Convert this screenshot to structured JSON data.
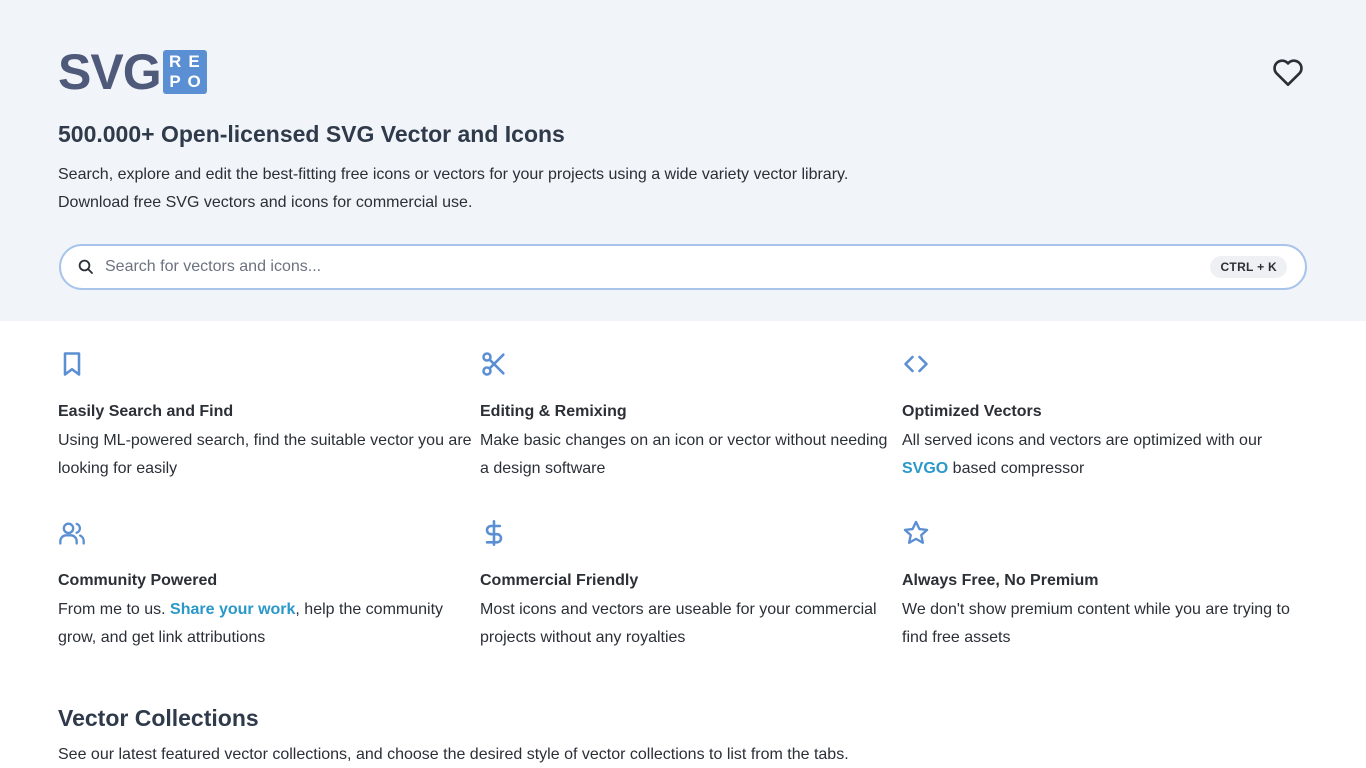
{
  "header": {
    "logo_text": "SVG",
    "logo_box": [
      "R",
      "E",
      "P",
      "O"
    ],
    "favorite_icon": "heart-icon"
  },
  "hero": {
    "title": "500.000+ Open-licensed SVG Vector and Icons",
    "desc_line1": "Search, explore and edit the best-fitting free icons or vectors for your projects using a wide variety vector library.",
    "desc_line2": "Download free SVG vectors and icons for commercial use."
  },
  "search": {
    "placeholder": "Search for vectors and icons...",
    "value": "",
    "shortcut": "CTRL + K",
    "icon": "search-icon"
  },
  "features": [
    {
      "icon": "bookmark-icon",
      "title": "Easily Search and Find",
      "text": "Using ML-powered search, find the suitable vector you are looking for easily"
    },
    {
      "icon": "scissors-icon",
      "title": "Editing & Remixing",
      "text": "Make basic changes on an icon or vector without needing a design software"
    },
    {
      "icon": "code-icon",
      "title": "Optimized Vectors",
      "text_before": "All served icons and vectors are optimized with our ",
      "link": "SVGO",
      "text_after": " based compressor"
    },
    {
      "icon": "users-icon",
      "title": "Community Powered",
      "text_before": "From me to us. ",
      "link": "Share your work",
      "text_after": ", help the community grow, and get link attributions"
    },
    {
      "icon": "dollar-icon",
      "title": "Commercial Friendly",
      "text": "Most icons and vectors are useable for your commercial projects without any royalties"
    },
    {
      "icon": "star-icon",
      "title": "Always Free, No Premium",
      "text": "We don't show premium content while you are trying to find free assets"
    }
  ],
  "collections": {
    "title": "Vector Collections",
    "desc": "See our latest featured vector collections, and choose the desired style of vector collections to list from the tabs."
  },
  "colors": {
    "accent": "#5b8fd3",
    "link": "#2a98c9",
    "hero_bg": "#f1f4f9",
    "logo_text": "#4f5a7a"
  }
}
